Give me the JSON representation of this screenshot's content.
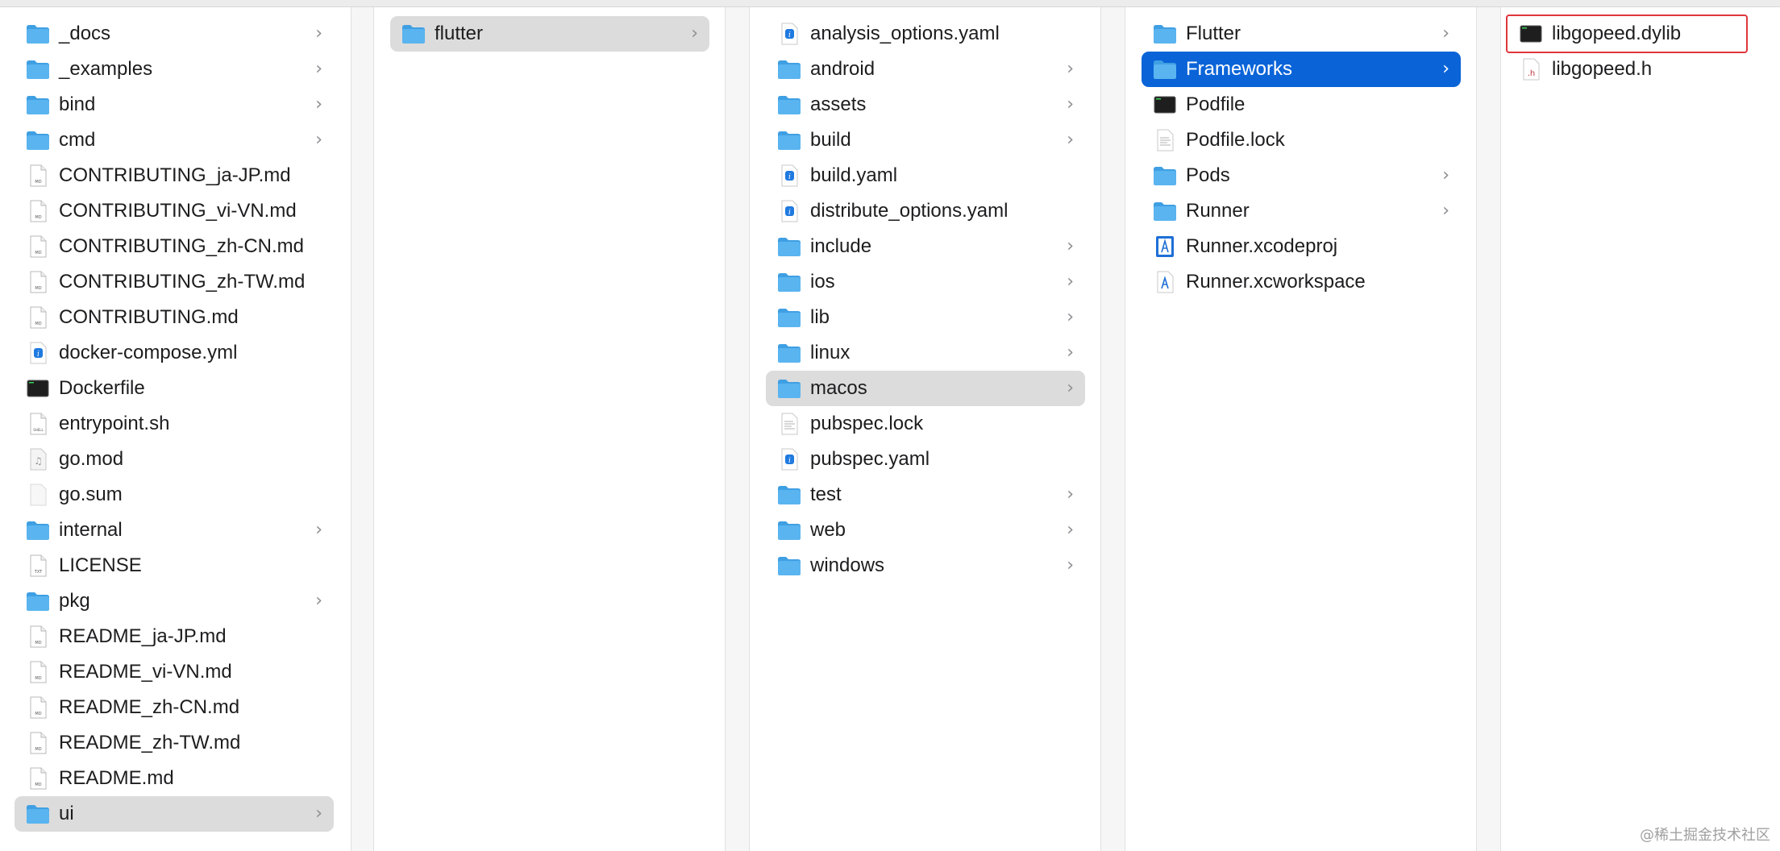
{
  "columns": [
    {
      "name": "root",
      "items": [
        {
          "label": "_docs",
          "type": "folder",
          "chevron": true
        },
        {
          "label": "_examples",
          "type": "folder",
          "chevron": true
        },
        {
          "label": "bind",
          "type": "folder",
          "chevron": true
        },
        {
          "label": "cmd",
          "type": "folder",
          "chevron": true
        },
        {
          "label": "CONTRIBUTING_ja-JP.md",
          "type": "md"
        },
        {
          "label": "CONTRIBUTING_vi-VN.md",
          "type": "md"
        },
        {
          "label": "CONTRIBUTING_zh-CN.md",
          "type": "md"
        },
        {
          "label": "CONTRIBUTING_zh-TW.md",
          "type": "md"
        },
        {
          "label": "CONTRIBUTING.md",
          "type": "md"
        },
        {
          "label": "docker-compose.yml",
          "type": "yaml"
        },
        {
          "label": "Dockerfile",
          "type": "exec"
        },
        {
          "label": "entrypoint.sh",
          "type": "shell"
        },
        {
          "label": "go.mod",
          "type": "audio"
        },
        {
          "label": "go.sum",
          "type": "blank"
        },
        {
          "label": "internal",
          "type": "folder",
          "chevron": true
        },
        {
          "label": "LICENSE",
          "type": "txt"
        },
        {
          "label": "pkg",
          "type": "folder",
          "chevron": true
        },
        {
          "label": "README_ja-JP.md",
          "type": "md"
        },
        {
          "label": "README_vi-VN.md",
          "type": "md"
        },
        {
          "label": "README_zh-CN.md",
          "type": "md"
        },
        {
          "label": "README_zh-TW.md",
          "type": "md"
        },
        {
          "label": "README.md",
          "type": "md"
        },
        {
          "label": "ui",
          "type": "folder",
          "chevron": true,
          "selected": "gray"
        }
      ]
    },
    {
      "name": "ui",
      "items": [
        {
          "label": "flutter",
          "type": "folder",
          "chevron": true,
          "selected": "gray"
        }
      ]
    },
    {
      "name": "flutter",
      "items": [
        {
          "label": "analysis_options.yaml",
          "type": "yaml"
        },
        {
          "label": "android",
          "type": "folder",
          "chevron": true
        },
        {
          "label": "assets",
          "type": "folder",
          "chevron": true
        },
        {
          "label": "build",
          "type": "folder",
          "chevron": true
        },
        {
          "label": "build.yaml",
          "type": "yaml"
        },
        {
          "label": "distribute_options.yaml",
          "type": "yaml"
        },
        {
          "label": "include",
          "type": "folder",
          "chevron": true
        },
        {
          "label": "ios",
          "type": "folder",
          "chevron": true
        },
        {
          "label": "lib",
          "type": "folder",
          "chevron": true
        },
        {
          "label": "linux",
          "type": "folder",
          "chevron": true
        },
        {
          "label": "macos",
          "type": "folder",
          "chevron": true,
          "selected": "gray"
        },
        {
          "label": "pubspec.lock",
          "type": "text"
        },
        {
          "label": "pubspec.yaml",
          "type": "yaml"
        },
        {
          "label": "test",
          "type": "folder",
          "chevron": true
        },
        {
          "label": "web",
          "type": "folder",
          "chevron": true
        },
        {
          "label": "windows",
          "type": "folder",
          "chevron": true
        }
      ]
    },
    {
      "name": "macos",
      "items": [
        {
          "label": "Flutter",
          "type": "folder",
          "chevron": true
        },
        {
          "label": "Frameworks",
          "type": "folder",
          "chevron": true,
          "selected": "blue"
        },
        {
          "label": "Podfile",
          "type": "exec"
        },
        {
          "label": "Podfile.lock",
          "type": "text"
        },
        {
          "label": "Pods",
          "type": "folder",
          "chevron": true
        },
        {
          "label": "Runner",
          "type": "folder",
          "chevron": true
        },
        {
          "label": "Runner.xcodeproj",
          "type": "xcode"
        },
        {
          "label": "Runner.xcworkspace",
          "type": "xcworkspace"
        }
      ]
    },
    {
      "name": "Frameworks",
      "items": [
        {
          "label": "libgopeed.dylib",
          "type": "exec",
          "outlined": true
        },
        {
          "label": "libgopeed.h",
          "type": "header"
        }
      ]
    }
  ],
  "chevron_glyph": "›",
  "watermark": "@稀土掘金技术社区",
  "colors": {
    "folder": "#5ab4ef",
    "folder_tab": "#3f9fe3",
    "selection_gray": "#dcdcdc",
    "selection_blue": "#0a64d8",
    "highlight_box": "#e0363c"
  }
}
